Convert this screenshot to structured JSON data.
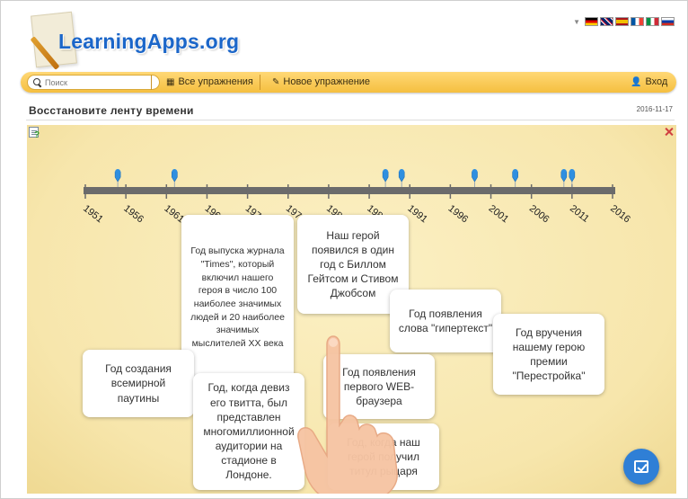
{
  "logo": {
    "text": "LearningApps.org"
  },
  "languages": [
    {
      "code": "de",
      "icon": "flag-de-icon"
    },
    {
      "code": "en",
      "icon": "flag-gb-icon"
    },
    {
      "code": "es",
      "icon": "flag-es-icon"
    },
    {
      "code": "fr",
      "icon": "flag-fr-icon"
    },
    {
      "code": "it",
      "icon": "flag-it-icon"
    },
    {
      "code": "ru",
      "icon": "flag-ru-icon"
    }
  ],
  "nav": {
    "search_placeholder": "Поиск",
    "all_exercises": "Все упражнения",
    "new_exercise": "Новое упражнение",
    "login": "Вход"
  },
  "page": {
    "title": "Восстановите ленту времени",
    "date": "2016-11-17"
  },
  "timeline": {
    "ticks": [
      "1951",
      "1956",
      "1961",
      "1966",
      "1971",
      "1976",
      "1981",
      "1986",
      "1991",
      "1996",
      "2001",
      "2006",
      "2011",
      "2016"
    ],
    "tick_labels_visible": [
      "1951",
      "1956",
      "1961",
      "196",
      "197",
      "197",
      "198",
      "198",
      "1991",
      "1996",
      "2001",
      "2006",
      "2011",
      "2016"
    ],
    "markers": [
      1955,
      1962,
      1988,
      1990,
      1999,
      2004,
      2010,
      2011
    ]
  },
  "cards": [
    {
      "text": "Год выпуска журнала \"Times\", который включил нашего героя в число 100 наиболее значимых людей и 20 наиболее значимых мыслителей XX века"
    },
    {
      "text": "Наш герой появился в один год с Биллом Гейтсом и Стивом Джобсом"
    },
    {
      "text": "Год появления слова \"гипертекст\""
    },
    {
      "text": "Год вручения нашему герою премии \"Перестройка\""
    },
    {
      "text": "Год создания всемирной паутины"
    },
    {
      "text": "Год появления первого WEB-браузера"
    },
    {
      "text": "Год, когда девиз его твитта, был представлен многомиллионной аудитории на стадионе в Лондоне."
    },
    {
      "text": "Год, когда наш герой получил титул рыцаря"
    }
  ],
  "colors": {
    "brand": "#1b66c9",
    "nav_bar": "#f5bf3f",
    "app_background": "#f8eab4",
    "timeline_bar": "#6b6b6b",
    "marker": "#2f8fe0",
    "check_button": "#2f7fd6"
  },
  "icons": {
    "search": "search-icon",
    "all_exercises": "grid-icon",
    "new_exercise": "pencil-icon",
    "login": "user-icon",
    "hint": "help-doc-icon",
    "fullscreen": "fullscreen-icon",
    "check": "check-icon"
  }
}
